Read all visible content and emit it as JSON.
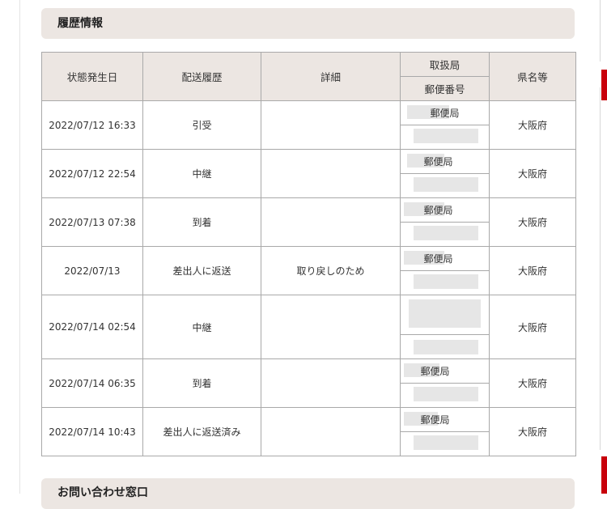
{
  "section_title": "履歴情報",
  "next_section_title": "お問い合わせ窓口",
  "table": {
    "headers": {
      "date": "状態発生日",
      "history": "配送履歴",
      "detail": "詳細",
      "office": "取扱局",
      "postal_code": "郵便番号",
      "prefecture": "県名等"
    },
    "rows": [
      {
        "date": "2022/07/12 16:33",
        "history": "引受",
        "detail": "",
        "office": "郵便局",
        "postal_code": "",
        "prefecture": "大阪府"
      },
      {
        "date": "2022/07/12 22:54",
        "history": "中継",
        "detail": "",
        "office": "郵便局",
        "postal_code": "",
        "prefecture": "大阪府"
      },
      {
        "date": "2022/07/13 07:38",
        "history": "到着",
        "detail": "",
        "office": "郵便局",
        "postal_code": "",
        "prefecture": "大阪府"
      },
      {
        "date": "2022/07/13",
        "history": "差出人に返送",
        "detail": "取り戻しのため",
        "office": "郵便局",
        "postal_code": "",
        "prefecture": "大阪府"
      },
      {
        "date": "2022/07/14 02:54",
        "history": "中継",
        "detail": "",
        "office": "",
        "postal_code": "",
        "prefecture": "大阪府"
      },
      {
        "date": "2022/07/14 06:35",
        "history": "到着",
        "detail": "",
        "office": "郵便局",
        "postal_code": "",
        "prefecture": "大阪府"
      },
      {
        "date": "2022/07/14 10:43",
        "history": "差出人に返送済み",
        "detail": "",
        "office": "郵便局",
        "postal_code": "",
        "prefecture": "大阪府"
      }
    ]
  },
  "colors": {
    "header_bg": "#ece6e2",
    "border": "#a9a9a9",
    "accent_red": "#c8000b",
    "redaction": "#e6e6e6"
  }
}
